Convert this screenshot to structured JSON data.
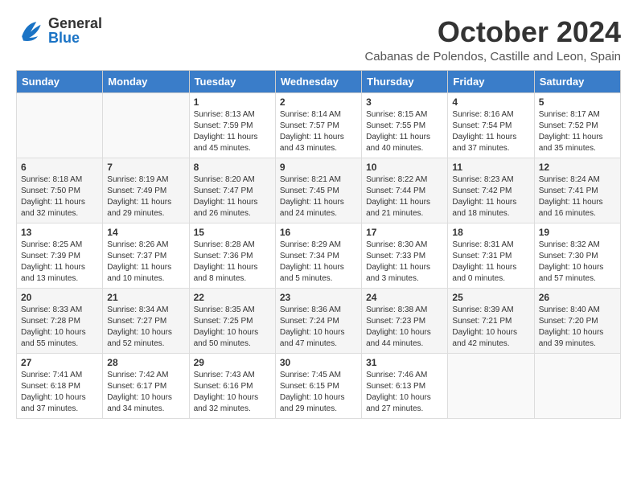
{
  "header": {
    "logo_general": "General",
    "logo_blue": "Blue",
    "month_title": "October 2024",
    "subtitle": "Cabanas de Polendos, Castille and Leon, Spain"
  },
  "days_of_week": [
    "Sunday",
    "Monday",
    "Tuesday",
    "Wednesday",
    "Thursday",
    "Friday",
    "Saturday"
  ],
  "weeks": [
    [
      {
        "day": "",
        "info": ""
      },
      {
        "day": "",
        "info": ""
      },
      {
        "day": "1",
        "info": "Sunrise: 8:13 AM\nSunset: 7:59 PM\nDaylight: 11 hours and 45 minutes."
      },
      {
        "day": "2",
        "info": "Sunrise: 8:14 AM\nSunset: 7:57 PM\nDaylight: 11 hours and 43 minutes."
      },
      {
        "day": "3",
        "info": "Sunrise: 8:15 AM\nSunset: 7:55 PM\nDaylight: 11 hours and 40 minutes."
      },
      {
        "day": "4",
        "info": "Sunrise: 8:16 AM\nSunset: 7:54 PM\nDaylight: 11 hours and 37 minutes."
      },
      {
        "day": "5",
        "info": "Sunrise: 8:17 AM\nSunset: 7:52 PM\nDaylight: 11 hours and 35 minutes."
      }
    ],
    [
      {
        "day": "6",
        "info": "Sunrise: 8:18 AM\nSunset: 7:50 PM\nDaylight: 11 hours and 32 minutes."
      },
      {
        "day": "7",
        "info": "Sunrise: 8:19 AM\nSunset: 7:49 PM\nDaylight: 11 hours and 29 minutes."
      },
      {
        "day": "8",
        "info": "Sunrise: 8:20 AM\nSunset: 7:47 PM\nDaylight: 11 hours and 26 minutes."
      },
      {
        "day": "9",
        "info": "Sunrise: 8:21 AM\nSunset: 7:45 PM\nDaylight: 11 hours and 24 minutes."
      },
      {
        "day": "10",
        "info": "Sunrise: 8:22 AM\nSunset: 7:44 PM\nDaylight: 11 hours and 21 minutes."
      },
      {
        "day": "11",
        "info": "Sunrise: 8:23 AM\nSunset: 7:42 PM\nDaylight: 11 hours and 18 minutes."
      },
      {
        "day": "12",
        "info": "Sunrise: 8:24 AM\nSunset: 7:41 PM\nDaylight: 11 hours and 16 minutes."
      }
    ],
    [
      {
        "day": "13",
        "info": "Sunrise: 8:25 AM\nSunset: 7:39 PM\nDaylight: 11 hours and 13 minutes."
      },
      {
        "day": "14",
        "info": "Sunrise: 8:26 AM\nSunset: 7:37 PM\nDaylight: 11 hours and 10 minutes."
      },
      {
        "day": "15",
        "info": "Sunrise: 8:28 AM\nSunset: 7:36 PM\nDaylight: 11 hours and 8 minutes."
      },
      {
        "day": "16",
        "info": "Sunrise: 8:29 AM\nSunset: 7:34 PM\nDaylight: 11 hours and 5 minutes."
      },
      {
        "day": "17",
        "info": "Sunrise: 8:30 AM\nSunset: 7:33 PM\nDaylight: 11 hours and 3 minutes."
      },
      {
        "day": "18",
        "info": "Sunrise: 8:31 AM\nSunset: 7:31 PM\nDaylight: 11 hours and 0 minutes."
      },
      {
        "day": "19",
        "info": "Sunrise: 8:32 AM\nSunset: 7:30 PM\nDaylight: 10 hours and 57 minutes."
      }
    ],
    [
      {
        "day": "20",
        "info": "Sunrise: 8:33 AM\nSunset: 7:28 PM\nDaylight: 10 hours and 55 minutes."
      },
      {
        "day": "21",
        "info": "Sunrise: 8:34 AM\nSunset: 7:27 PM\nDaylight: 10 hours and 52 minutes."
      },
      {
        "day": "22",
        "info": "Sunrise: 8:35 AM\nSunset: 7:25 PM\nDaylight: 10 hours and 50 minutes."
      },
      {
        "day": "23",
        "info": "Sunrise: 8:36 AM\nSunset: 7:24 PM\nDaylight: 10 hours and 47 minutes."
      },
      {
        "day": "24",
        "info": "Sunrise: 8:38 AM\nSunset: 7:23 PM\nDaylight: 10 hours and 44 minutes."
      },
      {
        "day": "25",
        "info": "Sunrise: 8:39 AM\nSunset: 7:21 PM\nDaylight: 10 hours and 42 minutes."
      },
      {
        "day": "26",
        "info": "Sunrise: 8:40 AM\nSunset: 7:20 PM\nDaylight: 10 hours and 39 minutes."
      }
    ],
    [
      {
        "day": "27",
        "info": "Sunrise: 7:41 AM\nSunset: 6:18 PM\nDaylight: 10 hours and 37 minutes."
      },
      {
        "day": "28",
        "info": "Sunrise: 7:42 AM\nSunset: 6:17 PM\nDaylight: 10 hours and 34 minutes."
      },
      {
        "day": "29",
        "info": "Sunrise: 7:43 AM\nSunset: 6:16 PM\nDaylight: 10 hours and 32 minutes."
      },
      {
        "day": "30",
        "info": "Sunrise: 7:45 AM\nSunset: 6:15 PM\nDaylight: 10 hours and 29 minutes."
      },
      {
        "day": "31",
        "info": "Sunrise: 7:46 AM\nSunset: 6:13 PM\nDaylight: 10 hours and 27 minutes."
      },
      {
        "day": "",
        "info": ""
      },
      {
        "day": "",
        "info": ""
      }
    ]
  ]
}
